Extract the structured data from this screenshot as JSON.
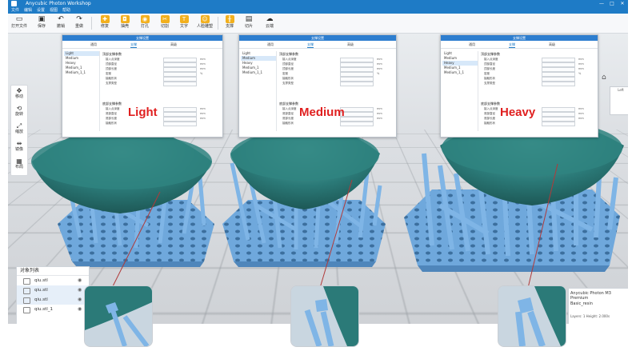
{
  "window": {
    "title": "Anycubic Photon Workshop",
    "minimize": "—",
    "maximize": "□",
    "close": "✕"
  },
  "menu": [
    "文件",
    "编辑",
    "设置",
    "视图",
    "帮助"
  ],
  "toolbar": [
    {
      "label": "打开文件",
      "icon": "folder-icon"
    },
    {
      "label": "保存",
      "icon": "save-icon"
    },
    {
      "label": "撤销",
      "icon": "undo-icon"
    },
    {
      "label": "重做",
      "icon": "redo-icon"
    },
    {
      "label": "修复",
      "icon": "repair-icon"
    },
    {
      "label": "抽壳",
      "icon": "hollow-icon"
    },
    {
      "label": "打孔",
      "icon": "punch-icon"
    },
    {
      "label": "切割",
      "icon": "cut-icon"
    },
    {
      "label": "文字",
      "icon": "text-icon"
    },
    {
      "label": "人脸雕塑",
      "icon": "relief-icon"
    },
    {
      "label": "支撑",
      "icon": "support-icon"
    },
    {
      "label": "切片",
      "icon": "slice-icon"
    },
    {
      "label": "云端",
      "icon": "cloud-icon"
    }
  ],
  "left_tools": [
    {
      "label": "移动",
      "icon": "move-icon"
    },
    {
      "label": "旋转",
      "icon": "rotate-icon"
    },
    {
      "label": "缩放",
      "icon": "scale-icon"
    },
    {
      "label": "镜像",
      "icon": "mirror-icon"
    },
    {
      "label": "布局",
      "icon": "layout-icon"
    }
  ],
  "viewcube_label": "Left",
  "dialogs": [
    {
      "title": "支撑设置",
      "tabs": [
        "通用",
        "支撑",
        "高级"
      ],
      "active_tab": 1,
      "list": [
        "Light",
        "Medium",
        "Heavy",
        "Medium_1",
        "Medium_1_1"
      ],
      "selected": 0
    },
    {
      "title": "支撑设置",
      "tabs": [
        "通用",
        "支撑",
        "高级"
      ],
      "active_tab": 1,
      "list": [
        "Light",
        "Medium",
        "Heavy",
        "Medium_1",
        "Medium_1_1"
      ],
      "selected": 1
    },
    {
      "title": "支撑设置",
      "tabs": [
        "通用",
        "支撑",
        "高级"
      ],
      "active_tab": 1,
      "list": [
        "Light",
        "Medium",
        "Heavy",
        "Medium_1",
        "Medium_1_1"
      ],
      "selected": 2
    }
  ],
  "dialog_sections": {
    "top": "顶部支撑参数",
    "top_rows": [
      {
        "k": "接入点深度",
        "u": "mm"
      },
      {
        "k": "顶部直径",
        "u": "mm"
      },
      {
        "k": "顶部长度",
        "u": "mm"
      },
      {
        "k": "密度",
        "u": "%"
      },
      {
        "k": "接触形状",
        "u": ""
      },
      {
        "k": "支撑类型",
        "u": ""
      }
    ],
    "bottom": "底部支撑参数",
    "bottom_rows": [
      {
        "k": "接入点深度",
        "u": "mm"
      },
      {
        "k": "底部直径",
        "u": "mm"
      },
      {
        "k": "底部长度",
        "u": "mm"
      },
      {
        "k": "接触形状",
        "u": ""
      }
    ]
  },
  "qualities": [
    {
      "label": "Light",
      "color": "#e02020"
    },
    {
      "label": "Medium",
      "color": "#e02020"
    },
    {
      "label": "Heavy",
      "color": "#e02020"
    }
  ],
  "object_list": {
    "header": "对象列表",
    "items": [
      "qiu.stl",
      "qiu.stl",
      "qiu.stl",
      "qiu.stl_1"
    ],
    "selected": [
      1,
      2
    ]
  },
  "printer_panel": {
    "printer": "Anycubic Photon M3 Premium",
    "resin": "Basic_resin",
    "meta": "Layers: 1  Height: 2.000s"
  },
  "colors": {
    "accent": "#1e7bc6",
    "model_blue": "#6fa8dc",
    "dome_teal": "#2b7a78",
    "label_red": "#e02020"
  }
}
